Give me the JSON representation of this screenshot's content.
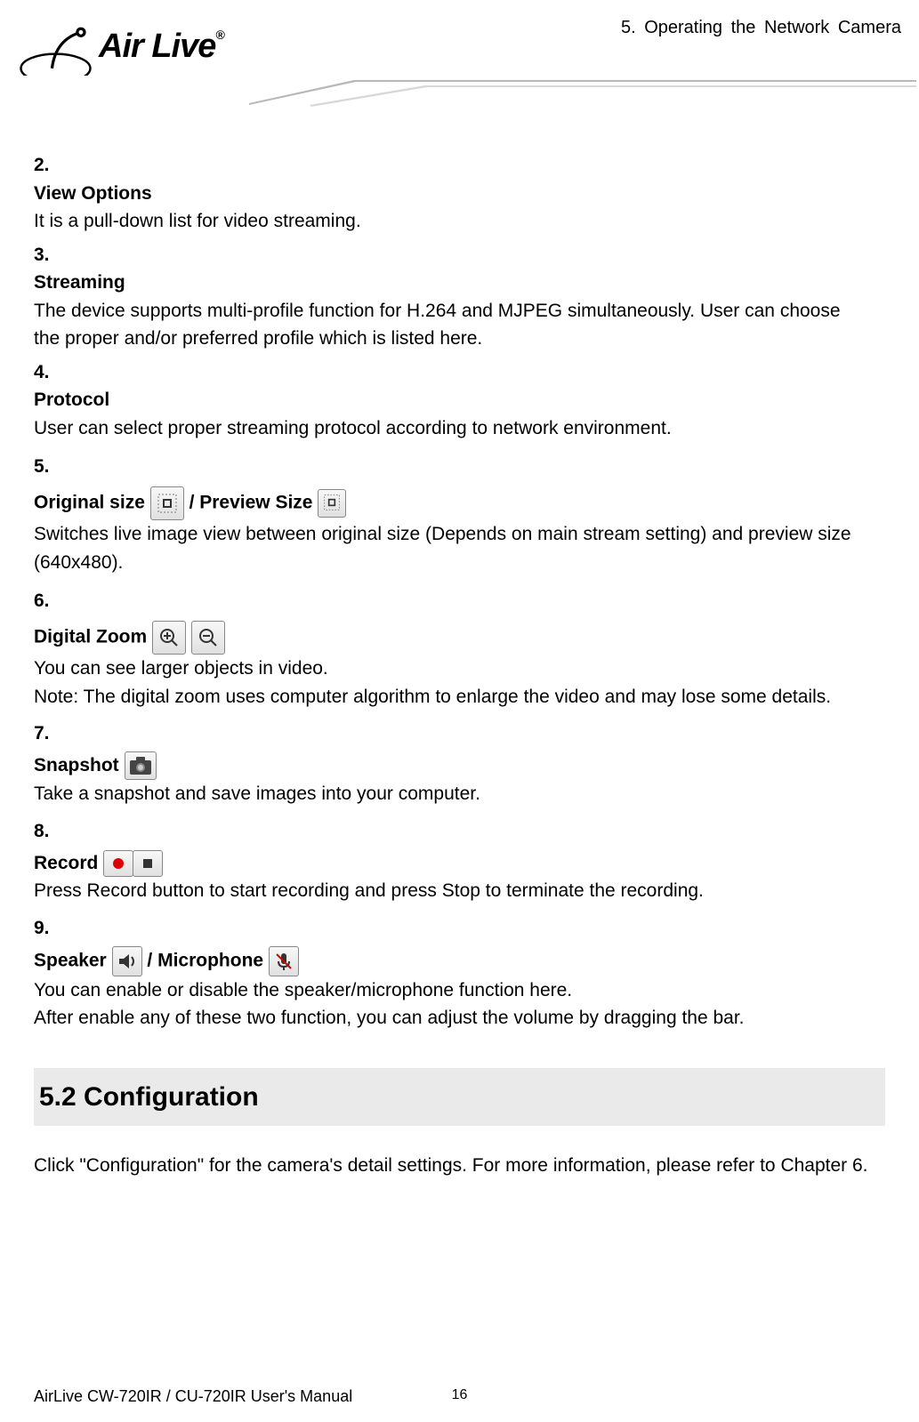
{
  "header": {
    "logo_text": "Air Live",
    "trademark": "®",
    "chapter_label": "5. Operating the Network Camera"
  },
  "items": [
    {
      "num": "2.",
      "title": "View Options",
      "desc": "It is a pull-down list for video streaming.",
      "icons": {}
    },
    {
      "num": "3.",
      "title": "Streaming",
      "desc": "The device supports multi-profile function for H.264 and MJPEG simultaneously. User can choose the proper and/or preferred profile which is listed here.",
      "icons": {}
    },
    {
      "num": "4.",
      "title": "Protocol",
      "desc": "User can select proper streaming protocol according to network environment.",
      "icons": {}
    },
    {
      "num": "5.",
      "title_before": "Original size",
      "title_mid": " / Preview Size",
      "desc": "Switches live image view between original size (Depends on main stream setting) and preview size (640x480).",
      "icons": {
        "first": "original-size-icon",
        "second": "preview-size-icon"
      }
    },
    {
      "num": "6.",
      "title_before": "Digital Zoom",
      "desc": "You can see larger objects in video.",
      "note": "Note: The digital zoom uses computer algorithm to enlarge the video and may lose some details.",
      "icons": {
        "first": "zoom-in-icon",
        "second": "zoom-out-icon"
      }
    },
    {
      "num": "7.",
      "title_before": "Snapshot",
      "desc": "Take a snapshot and save images into your computer.",
      "icons": {
        "first": "camera-icon"
      }
    },
    {
      "num": "8.",
      "title_before": "Record",
      "desc": "Press Record button to start recording and press Stop to terminate the recording.",
      "icons": {
        "first": "record-icon",
        "second": "stop-icon"
      }
    },
    {
      "num": "9.",
      "title_before": "Speaker ",
      "title_mid": " / Microphone ",
      "desc": "You can enable or disable the speaker/microphone function here.",
      "extra": "After enable any of these two function, you can adjust the volume by dragging the bar.",
      "icons": {
        "first": "speaker-icon",
        "second": "microphone-icon"
      }
    }
  ],
  "section": {
    "heading": "5.2 Configuration",
    "text": "Click \"Configuration\" for the camera's detail settings. For more information, please refer to Chapter 6."
  },
  "footer": {
    "manual": "AirLive CW-720IR / CU-720IR User's Manual",
    "page": "16"
  }
}
